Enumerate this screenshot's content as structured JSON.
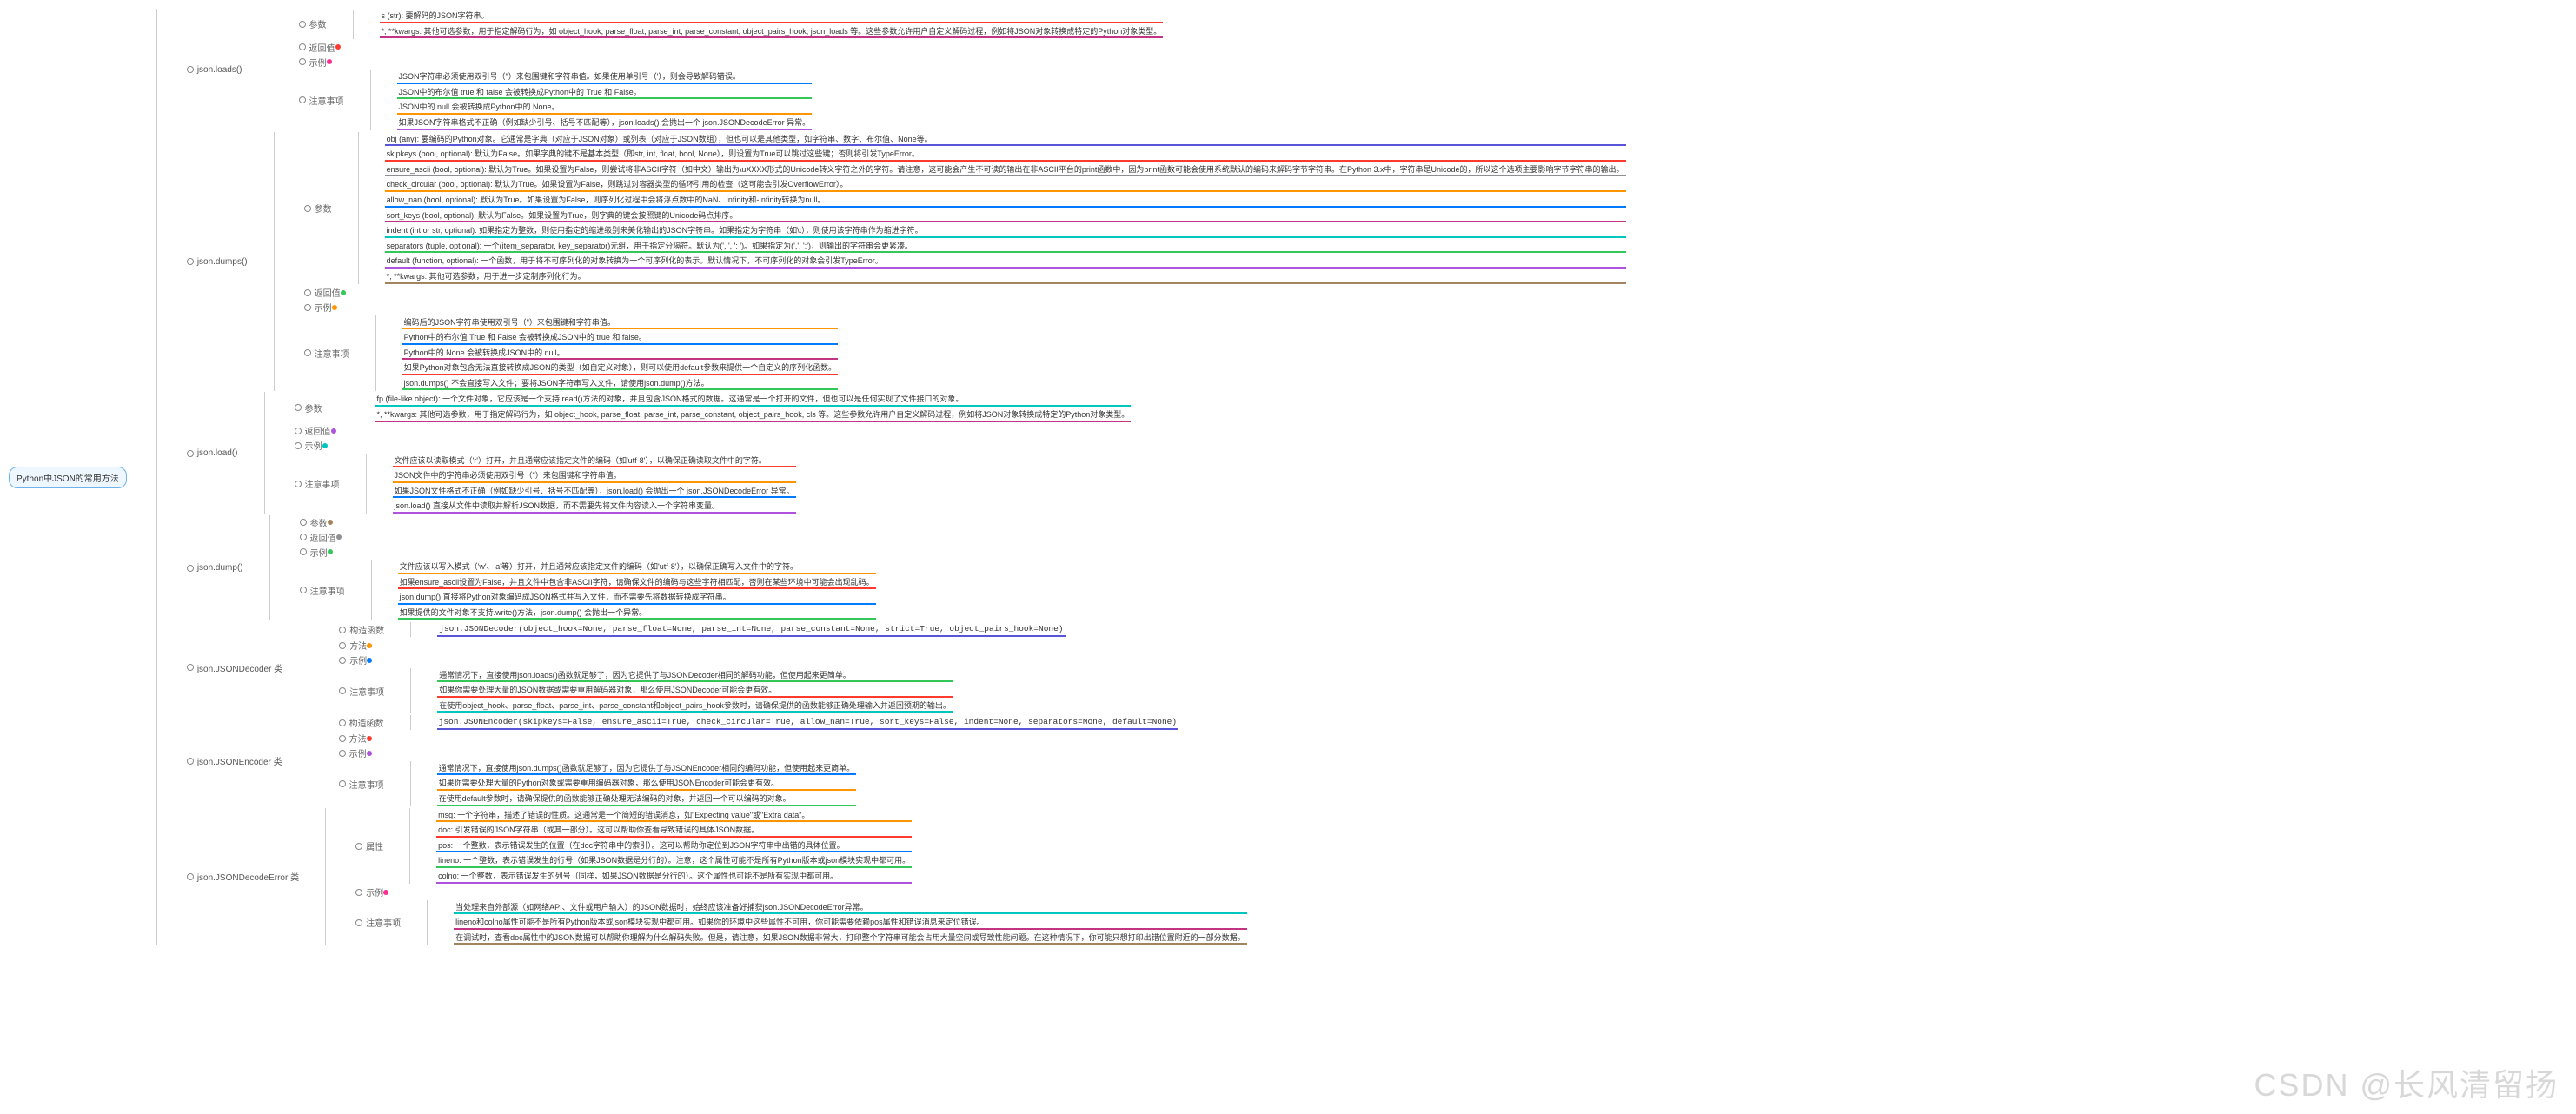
{
  "watermark": "CSDN @长风清留扬",
  "root": {
    "title": "Python中JSON的常用方法"
  },
  "sections": {
    "params": "参数",
    "return": "返回值",
    "example": "示例",
    "notes": "注意事项",
    "ctor": "构造函数",
    "methods": "方法",
    "attrs": "属性"
  },
  "methods": {
    "loads": {
      "name": "json.loads()",
      "params": [
        "s (str): 要解码的JSON字符串。",
        "*, **kwargs: 其他可选参数，用于指定解码行为，如 object_hook, parse_float, parse_int, parse_constant, object_pairs_hook, json_loads 等。这些参数允许用户自定义解码过程，例如将JSON对象转换成特定的Python对象类型。"
      ],
      "notes": [
        "JSON字符串必须使用双引号（\"）来包围键和字符串值。如果使用单引号（'），则会导致解码错误。",
        "JSON中的布尔值 true 和 false 会被转换成Python中的 True 和 False。",
        "JSON中的 null 会被转换成Python中的 None。",
        "如果JSON字符串格式不正确（例如缺少引号、括号不匹配等），json.loads() 会抛出一个 json.JSONDecodeError 异常。"
      ]
    },
    "dumps": {
      "name": "json.dumps()",
      "params": [
        "obj (any): 要编码的Python对象。它通常是字典（对应于JSON对象）或列表（对应于JSON数组），但也可以是其他类型，如字符串、数字、布尔值、None等。",
        "skipkeys (bool, optional): 默认为False。如果字典的键不是基本类型（即str, int, float, bool, None），则设置为True可以跳过这些键；否则将引发TypeError。",
        "ensure_ascii (bool, optional): 默认为True。如果设置为False，则尝试将非ASCII字符（如中文）输出为\\uXXXX形式的Unicode转义字符之外的字符。请注意，这可能会产生不可读的输出在非ASCII平台的print函数中，因为print函数可能会使用系统默认的编码来解码字节字符串。在Python 3.x中，字符串是Unicode的，所以这个选项主要影响字节字符串的输出。",
        "check_circular (bool, optional): 默认为True。如果设置为False，则跳过对容器类型的循环引用的检查（这可能会引发OverflowError）。",
        "allow_nan (bool, optional): 默认为True。如果设置为False，则序列化过程中会将浮点数中的NaN、Infinity和-Infinity转换为null。",
        "sort_keys (bool, optional): 默认为False。如果设置为True，则字典的键会按照键的Unicode码点排序。",
        "indent (int or str, optional): 如果指定为整数，则使用指定的缩进级别来美化输出的JSON字符串。如果指定为字符串（如\\t），则使用该字符串作为缩进字符。",
        "separators (tuple, optional): 一个(item_separator, key_separator)元组，用于指定分隔符。默认为(', ', ': ')。如果指定为(',', ':')，则输出的字符串会更紧凑。",
        "default (function, optional): 一个函数，用于将不可序列化的对象转换为一个可序列化的表示。默认情况下，不可序列化的对象会引发TypeError。",
        "*, **kwargs: 其他可选参数，用于进一步定制序列化行为。"
      ],
      "notes": [
        "编码后的JSON字符串使用双引号（\"）来包围键和字符串值。",
        "Python中的布尔值 True 和 False 会被转换成JSON中的 true 和 false。",
        "Python中的 None 会被转换成JSON中的 null。",
        "如果Python对象包含无法直接转换成JSON的类型（如自定义对象），则可以使用default参数来提供一个自定义的序列化函数。",
        "json.dumps() 不会直接写入文件；要将JSON字符串写入文件，请使用json.dump()方法。"
      ]
    },
    "load": {
      "name": "json.load()",
      "params": [
        "fp (file-like object): 一个文件对象，它应该是一个支持.read()方法的对象，并且包含JSON格式的数据。这通常是一个打开的文件，但也可以是任何实现了文件接口的对象。",
        "*, **kwargs: 其他可选参数，用于指定解码行为，如 object_hook, parse_float, parse_int, parse_constant, object_pairs_hook, cls 等。这些参数允许用户自定义解码过程，例如将JSON对象转换成特定的Python对象类型。"
      ],
      "notes": [
        "文件应该以读取模式（'r'）打开，并且通常应该指定文件的编码（如'utf-8'），以确保正确读取文件中的字符。",
        "JSON文件中的字符串必须使用双引号（\"）来包围键和字符串值。",
        "如果JSON文件格式不正确（例如缺少引号、括号不匹配等），json.load() 会抛出一个 json.JSONDecodeError 异常。",
        "json.load() 直接从文件中读取并解析JSON数据，而不需要先将文件内容读入一个字符串变量。"
      ]
    },
    "dump": {
      "name": "json.dump()",
      "notes": [
        "文件应该以写入模式（'w'、'a'等）打开，并且通常应该指定文件的编码（如'utf-8'），以确保正确写入文件中的字符。",
        "如果ensure_ascii设置为False，并且文件中包含非ASCII字符，请确保文件的编码与这些字符相匹配，否则在某些环境中可能会出现乱码。",
        "json.dump() 直接将Python对象编码成JSON格式并写入文件，而不需要先将数据转换成字符串。",
        "如果提供的文件对象不支持.write()方法，json.dump() 会抛出一个异常。"
      ]
    },
    "decoder": {
      "name": "json.JSONDecoder 类",
      "ctor": "json.JSONDecoder(object_hook=None, parse_float=None, parse_int=None, parse_constant=None, strict=True, object_pairs_hook=None)",
      "notes": [
        "通常情况下，直接使用json.loads()函数就足够了，因为它提供了与JSONDecoder相同的解码功能，但使用起来更简单。",
        "如果你需要处理大量的JSON数据或需要重用解码器对象，那么使用JSONDecoder可能会更有效。",
        "在使用object_hook、parse_float、parse_int、parse_constant和object_pairs_hook参数时，请确保提供的函数能够正确处理输入并返回预期的输出。"
      ]
    },
    "encoder": {
      "name": "json.JSONEncoder 类",
      "ctor": "json.JSONEncoder(skipkeys=False, ensure_ascii=True, check_circular=True, allow_nan=True, sort_keys=False, indent=None, separators=None, default=None)",
      "notes": [
        "通常情况下，直接使用json.dumps()函数就足够了，因为它提供了与JSONEncoder相同的编码功能，但使用起来更简单。",
        "如果你需要处理大量的Python对象或需要重用编码器对象，那么使用JSONEncoder可能会更有效。",
        "在使用default参数时，请确保提供的函数能够正确处理无法编码的对象，并返回一个可以编码的对象。"
      ]
    },
    "error": {
      "name": "json.JSONDecodeError 类",
      "attrs": [
        "msg: 一个字符串，描述了错误的性质。这通常是一个简短的错误消息，如\"Expecting value\"或\"Extra data\"。",
        "doc: 引发错误的JSON字符串（或其一部分）。这可以帮助你查看导致错误的具体JSON数据。",
        "pos: 一个整数，表示错误发生的位置（在doc字符串中的索引）。这可以帮助你定位到JSON字符串中出错的具体位置。",
        "lineno: 一个整数，表示错误发生的行号（如果JSON数据是分行的）。注意，这个属性可能不是所有Python版本或json模块实现中都可用。",
        "colno: 一个整数，表示错误发生的列号（同样，如果JSON数据是分行的）。这个属性也可能不是所有实现中都可用。"
      ],
      "notes": [
        "当处理来自外部源（如网络API、文件或用户输入）的JSON数据时，始终应该准备好捕获json.JSONDecodeError异常。",
        "lineno和colno属性可能不是所有Python版本或json模块实现中都可用。如果你的环境中这些属性不可用，你可能需要依赖pos属性和错误消息来定位错误。",
        "在调试时，查看doc属性中的JSON数据可以帮助你理解为什么解码失败。但是，请注意，如果JSON数据非常大，打印整个字符串可能会占用大量空间或导致性能问题。在这种情况下，你可能只想打印出错位置附近的一部分数据。"
      ]
    }
  }
}
